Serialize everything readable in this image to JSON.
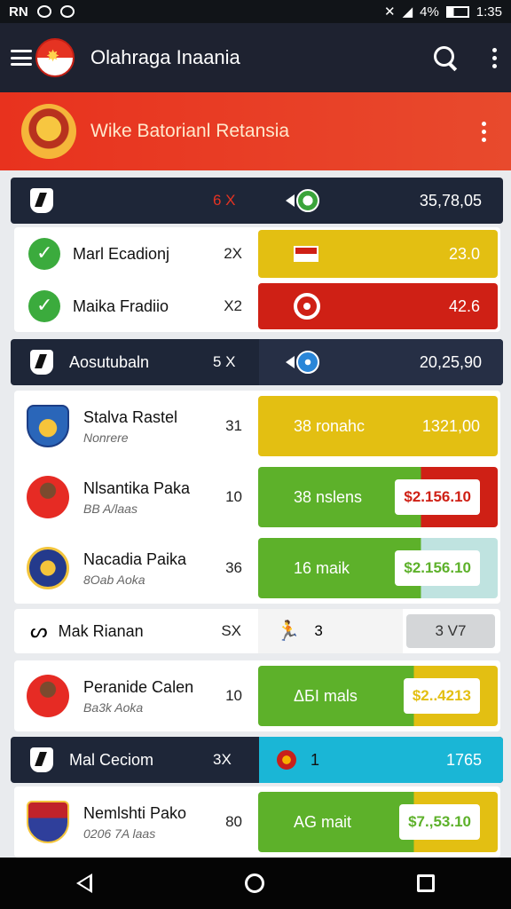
{
  "status_bar": {
    "left_icons": [
      "RN",
      "O",
      "☺"
    ],
    "battery": "4%",
    "time": "1:35"
  },
  "app_bar": {
    "title": "Olahraga Inaania"
  },
  "banner": {
    "title": "Wike Batorianl Retansia"
  },
  "groups": [
    {
      "name": "",
      "count": "6 X",
      "value": "35,78,05"
    },
    {
      "name": "Aosutubaln",
      "count": "5 X",
      "value": "20,25,90"
    },
    {
      "name": "Mal Ceciom",
      "count": "3X",
      "value": "1765",
      "secondary": "1"
    }
  ],
  "rows_a": [
    {
      "name": "Marl Ecadionj",
      "num": "2X",
      "value": "23.0"
    },
    {
      "name": "Maika Fradiio",
      "num": "X2",
      "value": "42.6"
    }
  ],
  "rows_b": [
    {
      "name": "Stalva Rastel",
      "sub": "Nonrere",
      "num": "31",
      "label": "38 ronahc",
      "value": "1321,00"
    },
    {
      "name": "Nlsantika Paka",
      "sub": "BB A/laas",
      "num": "10",
      "label": "38 nslens",
      "price": "$2.156.10"
    },
    {
      "name": "Nacadia Paika",
      "sub": "8Oab Aoka",
      "num": "36",
      "label": "16 maik",
      "price": "$2.156.10"
    }
  ],
  "thin_row": {
    "name": "Mak Rianan",
    "num": "SX",
    "mid_value": "3",
    "right_value": "3 V7"
  },
  "rows_c": [
    {
      "name": "Peranide Calen",
      "sub": "Ba3k Aoka",
      "num": "10",
      "label": "ΔБI mals",
      "price": "$2..4213"
    }
  ],
  "rows_d": [
    {
      "name": "Nemlshti Pako",
      "sub": "0206 7A laas",
      "num": "80",
      "label": "AG mait",
      "price": "$7.,53.10"
    }
  ]
}
